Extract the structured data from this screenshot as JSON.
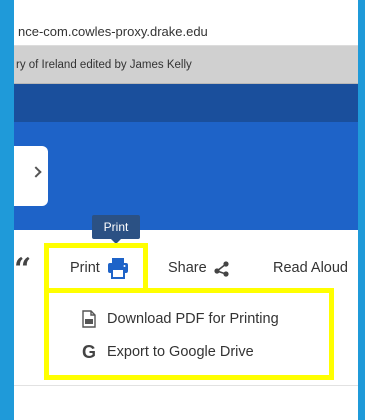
{
  "browser": {
    "url": "nce-com.cowles-proxy.drake.edu",
    "tab_title": "ry of Ireland edited by James Kelly"
  },
  "tooltip": {
    "text": "Print"
  },
  "toolbar": {
    "print_label": "Print",
    "share_label": "Share",
    "read_aloud_label": "Read Aloud",
    "quote_glyph": "“"
  },
  "print_menu": {
    "items": [
      {
        "label": "Download PDF for Printing",
        "icon": "pdf-document-icon"
      },
      {
        "label": "Export to Google Drive",
        "icon": "google-g-icon"
      }
    ]
  },
  "colors": {
    "frame_blue": "#1f9ad9",
    "header_blue": "#1e63c8",
    "highlight_yellow": "#ffff00",
    "tooltip_bg": "#2b5184"
  }
}
